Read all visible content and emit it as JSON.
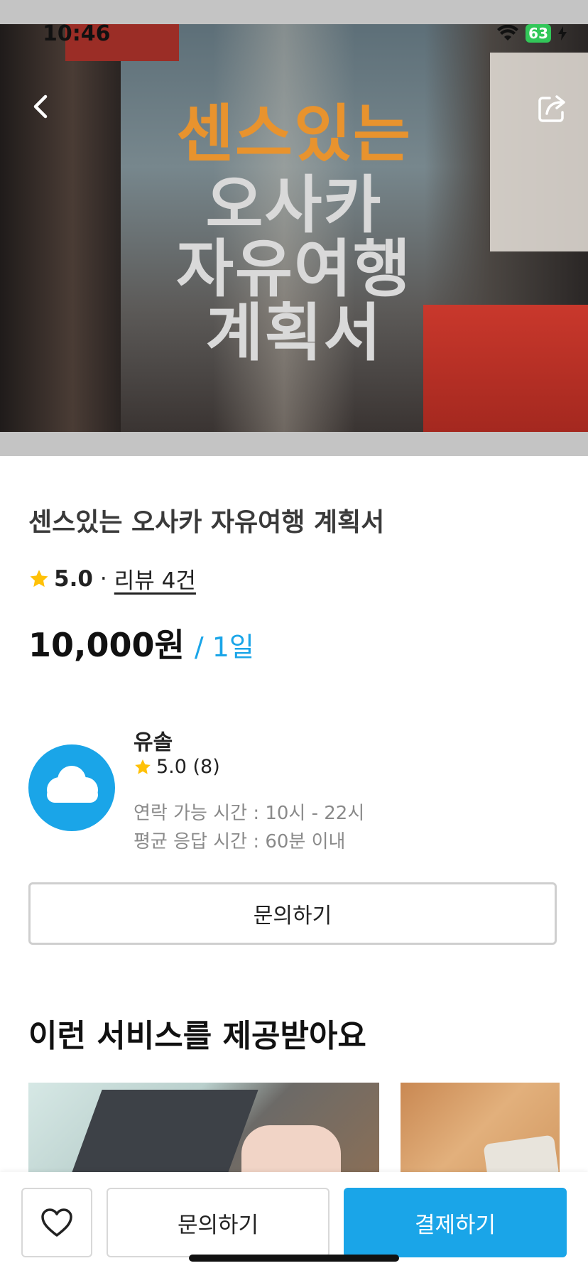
{
  "status_bar": {
    "time": "10:46",
    "battery": "63"
  },
  "hero": {
    "lines": [
      "센스있는",
      "오사카",
      "자유여행",
      "계획서"
    ],
    "title_color": "#e8932e"
  },
  "product": {
    "title": "센스있는 오사카 자유여행 계획서",
    "rating": "5.0",
    "separator": "·",
    "reviews": "리뷰 4건",
    "price": "10,000원",
    "unit": "/ 1일"
  },
  "seller": {
    "name": "유솔",
    "rating": "5.0 (8)",
    "contact_hours": "연락 가능 시간 : 10시 - 22시",
    "response_time": "평균 응답 시간 : 60분 이내",
    "inquire_label": "문의하기"
  },
  "section": {
    "title": "이런 서비스를 제공받아요"
  },
  "bottom_bar": {
    "inquire_label": "문의하기",
    "pay_label": "결제하기",
    "accent": "#1aa5e8"
  },
  "icons": {
    "back": "chevron-left-icon",
    "share": "share-icon",
    "star": "star-icon",
    "heart": "heart-icon",
    "wifi": "wifi-icon"
  }
}
